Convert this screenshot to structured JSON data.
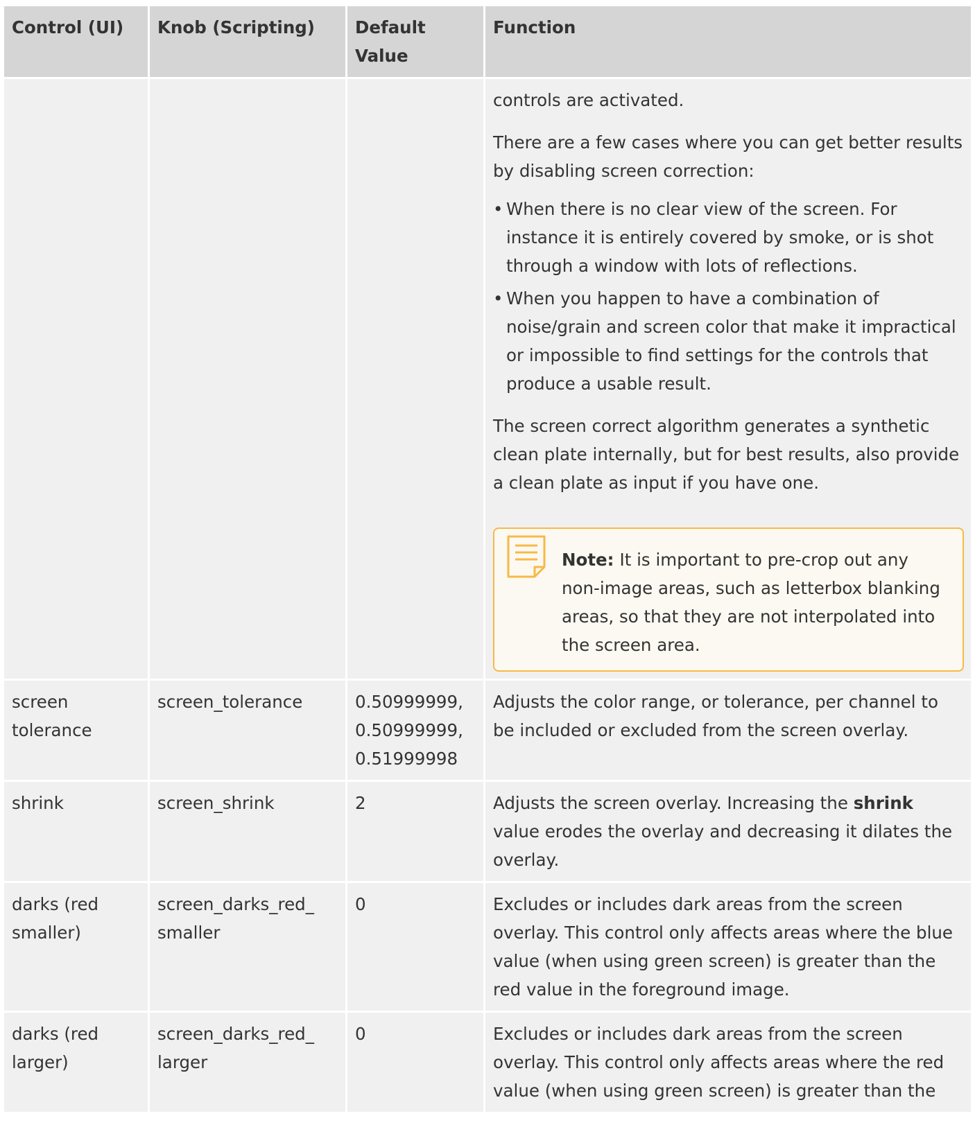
{
  "table": {
    "headers": [
      "Control (UI)",
      "Knob (Scripting)",
      "Default Value",
      "Function"
    ],
    "continued": {
      "p1": "controls are activated.",
      "p2": "There are a few cases where you can get better results by disabling screen correction:",
      "bullets": [
        "When there is no clear view of the screen. For instance it is entirely covered by smoke, or is shot through a window with lots of reflections.",
        "When you happen to have a combination of noise/grain and screen color that make it impractical or impossible to find settings for the controls that produce a usable result."
      ],
      "p3": "The screen correct algorithm generates a synthetic clean plate internally, but for best results, also provide a clean plate as input if you have one.",
      "note": {
        "icon": "note-icon",
        "label": "Note:",
        "text": "It is important to pre-crop out any non-image areas, such as letterbox blanking areas, so that they are not interpolated into the screen area."
      }
    },
    "rows": [
      {
        "control": "screen tolerance",
        "knob": "screen_tolerance",
        "default": "0.50999999, 0.50999999, 0.51999998",
        "function": "Adjusts the color range, or tolerance, per channel to be included or excluded from the screen overlay."
      },
      {
        "control": "shrink",
        "knob": "screen_shrink",
        "default": "2",
        "function_pre": "Adjusts the screen overlay. Increasing the",
        "function_bold": "shrink",
        "function_post": "value erodes the overlay and decreasing it dilates the overlay."
      },
      {
        "control": "darks (red smaller)",
        "knob": "screen_darks_red_ smaller",
        "default": "0",
        "function": "Excludes or includes dark areas from the screen overlay. This control only affects areas where the blue value (when using green screen) is greater than the red value in the foreground image."
      },
      {
        "control": "darks (red larger)",
        "knob": "screen_darks_red_ larger",
        "default": "0",
        "function": "Excludes or includes dark areas from the screen overlay. This control only affects areas where the red value (when using green screen) is greater than the"
      }
    ]
  },
  "colors": {
    "header_bg": "#d5d5d5",
    "row_bg": "#f0f0f0",
    "note_border": "#f7b947",
    "text": "#333333"
  }
}
